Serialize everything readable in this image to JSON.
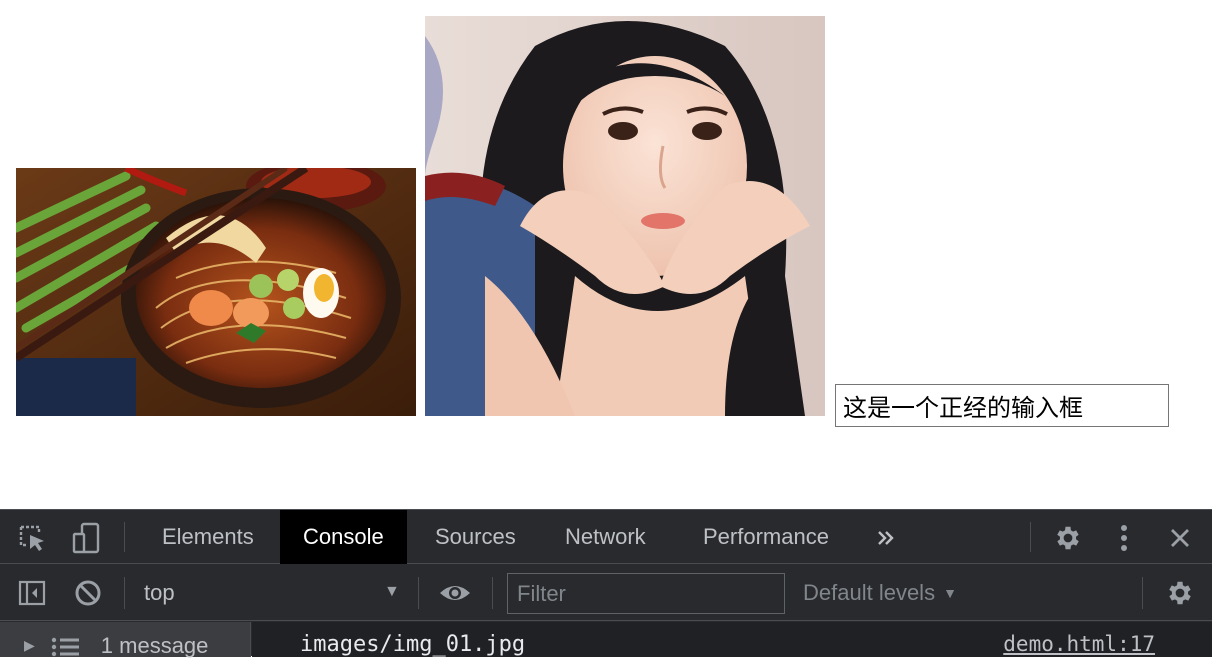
{
  "page": {
    "input_value": "这是一个正经的输入框"
  },
  "devtools": {
    "tabs": [
      {
        "label": "Elements",
        "active": false
      },
      {
        "label": "Console",
        "active": true
      },
      {
        "label": "Sources",
        "active": false
      },
      {
        "label": "Network",
        "active": false
      },
      {
        "label": "Performance",
        "active": false
      }
    ],
    "more_tabs_icon": "double-chevron-right-icon",
    "context_value": "top",
    "filter_placeholder": "Filter",
    "levels_label": "Default levels",
    "sidebar_message": "1 message",
    "log_message": "images/img_01.jpg",
    "log_source": "demo.html:17"
  },
  "colors": {
    "devtools_bg": "#292a2d",
    "active_tab_bg": "#000000",
    "log_bg": "#202124",
    "sidebar_selected_bg": "#3c3d40"
  }
}
